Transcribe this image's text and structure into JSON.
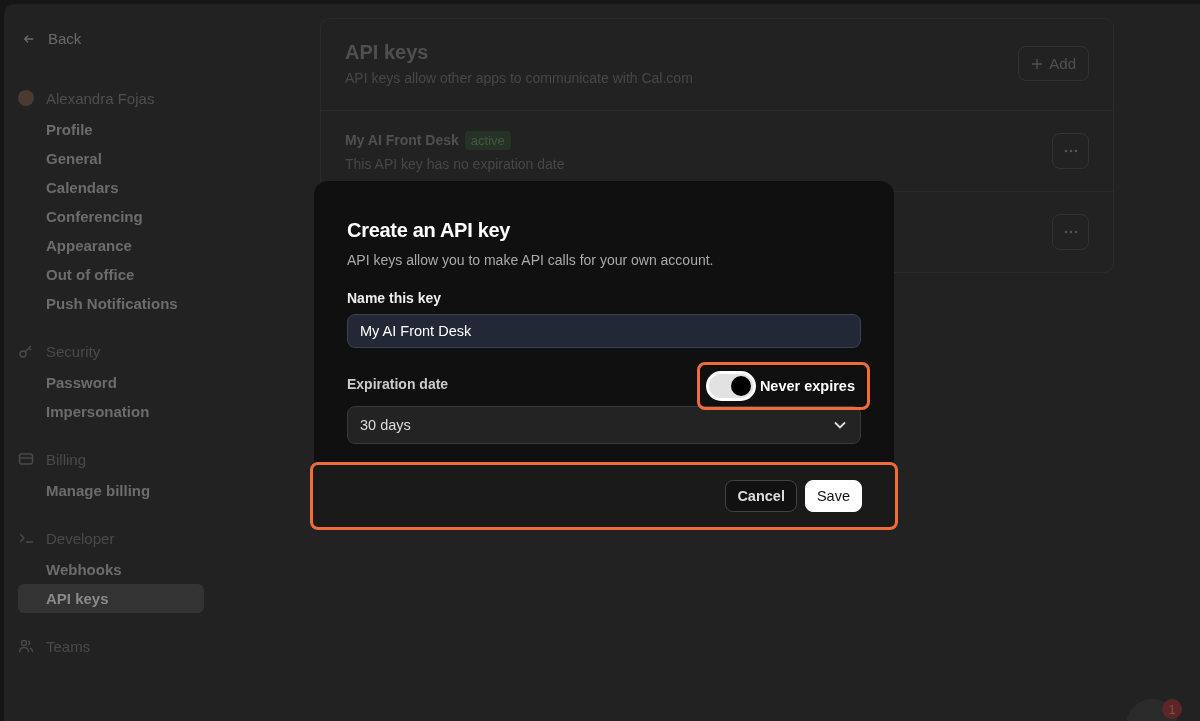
{
  "sidebar": {
    "back": "Back",
    "groups": [
      {
        "kind": "user",
        "title": "Alexandra Fojas",
        "items": [
          {
            "label": "Profile",
            "selected": false
          },
          {
            "label": "General",
            "selected": false
          },
          {
            "label": "Calendars",
            "selected": false
          },
          {
            "label": "Conferencing",
            "selected": false
          },
          {
            "label": "Appearance",
            "selected": false
          },
          {
            "label": "Out of office",
            "selected": false
          },
          {
            "label": "Push Notifications",
            "selected": false
          }
        ]
      },
      {
        "kind": "key",
        "title": "Security",
        "items": [
          {
            "label": "Password",
            "selected": false
          },
          {
            "label": "Impersonation",
            "selected": false
          }
        ]
      },
      {
        "kind": "card",
        "title": "Billing",
        "items": [
          {
            "label": "Manage billing",
            "selected": false
          }
        ]
      },
      {
        "kind": "terminal",
        "title": "Developer",
        "items": [
          {
            "label": "Webhooks",
            "selected": false
          },
          {
            "label": "API keys",
            "selected": true
          }
        ]
      },
      {
        "kind": "people",
        "title": "Teams"
      }
    ]
  },
  "page": {
    "title": "API keys",
    "subtitle": "API keys allow other apps to communicate with Cal.com",
    "add_button": "Add",
    "keys": [
      {
        "menu": true,
        "name": "My AI Front Desk",
        "badge": "active",
        "description": "This API key has no expiration date"
      },
      {
        "menu": true
      }
    ]
  },
  "dialog": {
    "title": "Create an API key",
    "subtitle": "API keys allow you to make API calls for your own account.",
    "name_label": "Name this key",
    "name_value": "My AI Front Desk",
    "expiry_label": "Expiration date",
    "never_expires": {
      "label": "Never expires",
      "on": true
    },
    "duration": "30 days",
    "buttons": {
      "cancel": "Cancel",
      "save": "Save"
    }
  },
  "chat_badge": "1"
}
